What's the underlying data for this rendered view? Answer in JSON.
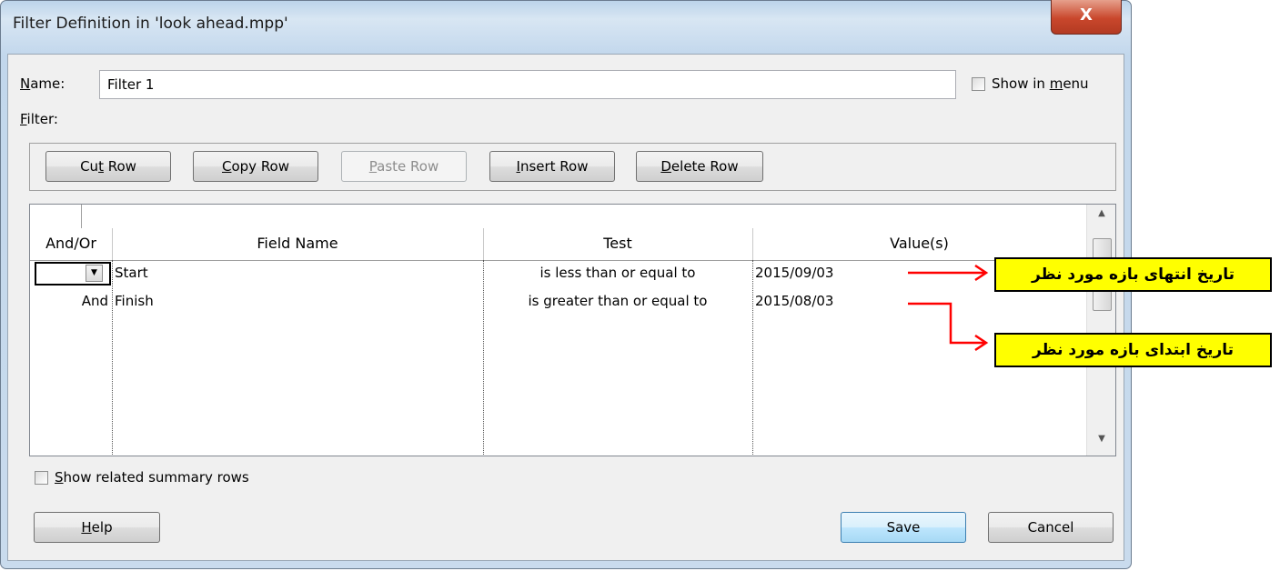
{
  "window": {
    "title": "Filter Definition in 'look ahead.mpp'",
    "close_glyph": "X"
  },
  "name_row": {
    "label_u": "N",
    "label_rest": "ame:",
    "value": "Filter 1",
    "show_in_menu_pre": "Show in ",
    "show_in_menu_u": "m",
    "show_in_menu_post": "enu",
    "show_in_menu_checked": false
  },
  "filter_label": {
    "u": "F",
    "rest": "ilter:"
  },
  "toolbar": {
    "cut": {
      "pre": "Cu",
      "u": "t",
      "post": " Row"
    },
    "copy": {
      "pre": "",
      "u": "C",
      "post": "opy Row"
    },
    "paste": {
      "pre": "",
      "u": "P",
      "post": "aste Row",
      "enabled": false
    },
    "insert": {
      "pre": "",
      "u": "I",
      "post": "nsert Row"
    },
    "delete": {
      "pre": "",
      "u": "D",
      "post": "elete Row"
    }
  },
  "grid": {
    "headers": [
      "And/Or",
      "Field Name",
      "Test",
      "Value(s)"
    ],
    "rows": [
      {
        "andor": "",
        "field": "Start",
        "test": "is less than or equal to",
        "value": "2015/09/03"
      },
      {
        "andor": "And",
        "field": "Finish",
        "test": "is greater than or equal to",
        "value": "2015/08/03"
      }
    ]
  },
  "summary_rows": {
    "u": "S",
    "rest": "how related summary rows",
    "checked": false
  },
  "footer": {
    "help": {
      "u": "H",
      "rest": "elp"
    },
    "save": "Save",
    "cancel": "Cancel"
  },
  "annotations": {
    "end": "تاریخ انتهای بازه مورد نظر",
    "start": "تاریخ ابتدای بازه مورد نظر",
    "arrow_color": "#ff0000",
    "box_color": "#ffff00"
  }
}
